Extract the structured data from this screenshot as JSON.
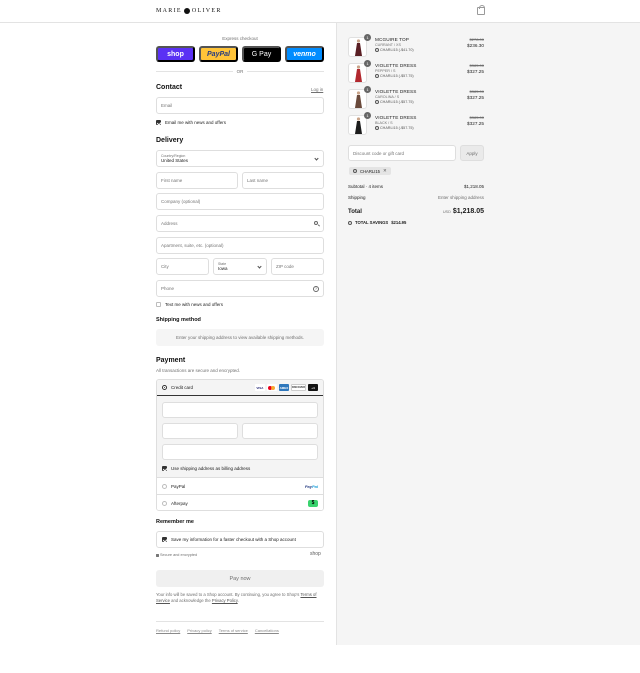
{
  "header": {
    "brand_left": "MARIE",
    "brand_right": "OLIVER",
    "icons": {
      "brand_mark": "brand-mark-icon",
      "cart": "shopping-bag-icon"
    }
  },
  "express": {
    "title": "Express checkout",
    "shop": "shop",
    "paypal": "PayPal",
    "gpay": "G Pay",
    "venmo": "venmo",
    "or": "OR",
    "colors": {
      "shop": "#5a31f4",
      "paypal": "#ffc439",
      "gpay": "#000000",
      "venmo": "#008cff"
    }
  },
  "contact": {
    "heading": "Contact",
    "login": "Log in",
    "email_placeholder": "Email",
    "news_label": "Email me with news and offers",
    "news_checked": true
  },
  "delivery": {
    "heading": "Delivery",
    "country_label": "Country/Region",
    "country_value": "United States",
    "first_name": "First name",
    "last_name": "Last name",
    "company": "Company (optional)",
    "address": "Address",
    "apartment": "Apartment, suite, etc. (optional)",
    "city": "City",
    "state_label": "State",
    "state_value": "Iowa",
    "zip": "ZIP code",
    "phone": "Phone",
    "text_label": "Text me with news and offers",
    "text_checked": false
  },
  "shipping": {
    "heading": "Shipping method",
    "placeholder": "Enter your shipping address to view available shipping methods."
  },
  "payment": {
    "heading": "Payment",
    "subtitle": "All transactions are secure and encrypted.",
    "credit_card": "Credit card",
    "card_brands": [
      "VISA",
      "MC",
      "AMEX",
      "DISCOVER",
      "+4"
    ],
    "billing_label": "Use shipping address as billing address",
    "billing_checked": true,
    "paypal": "PayPal",
    "paypal_logo_a": "Pay",
    "paypal_logo_b": "Pal",
    "afterpay": "Afterpay",
    "afterpay_logo": "$"
  },
  "remember": {
    "heading": "Remember me",
    "label": "Save my information for a faster checkout with a Shop account",
    "checked": true,
    "secure": "Secure and encrypted",
    "shop_logo": "shop"
  },
  "pay_now": "Pay now",
  "legal": {
    "text_a": "Your info will be saved to a Shop account. By continuing, you agree to Shop's",
    "terms": "Terms of Service",
    "text_b": "and acknowledge the",
    "privacy": "Privacy Policy",
    "end": "."
  },
  "footer_links": [
    "Refund policy",
    "Privacy policy",
    "Terms of service",
    "Cancellations"
  ],
  "cart": {
    "items": [
      {
        "name": "MCGUIRE TOP",
        "variant": "CURRANT / XS",
        "discount": "CHARLI15 (-$41.70)",
        "original": "$278.00",
        "price": "$236.30",
        "qty": "1",
        "dress_color": "#5a1f24"
      },
      {
        "name": "VIOLETTE DRESS",
        "variant": "PEPPER / S",
        "discount": "CHARLI15 (-$57.75)",
        "original": "$385.00",
        "price": "$327.25",
        "qty": "1",
        "dress_color": "#b2282e"
      },
      {
        "name": "VIOLETTE DRESS",
        "variant": "CAROLINA / S",
        "discount": "CHARLI15 (-$57.75)",
        "original": "$385.00",
        "price": "$327.25",
        "qty": "1",
        "dress_color": "#6a4a3c"
      },
      {
        "name": "VIOLETTE DRESS",
        "variant": "BLACK / S",
        "discount": "CHARLI15 (-$57.75)",
        "original": "$385.00",
        "price": "$327.25",
        "qty": "1",
        "dress_color": "#1c1c1c"
      }
    ],
    "discount_placeholder": "Discount code or gift card",
    "apply": "Apply",
    "applied_code": "CHARLI15",
    "subtotal_label": "Subtotal · 4 items",
    "subtotal_value": "$1,218.05",
    "shipping_label": "Shipping",
    "shipping_value": "Enter shipping address",
    "total_label": "Total",
    "currency": "USD",
    "total_value": "$1,218.05",
    "savings_label": "TOTAL SAVINGS",
    "savings_value": "$214.95"
  }
}
